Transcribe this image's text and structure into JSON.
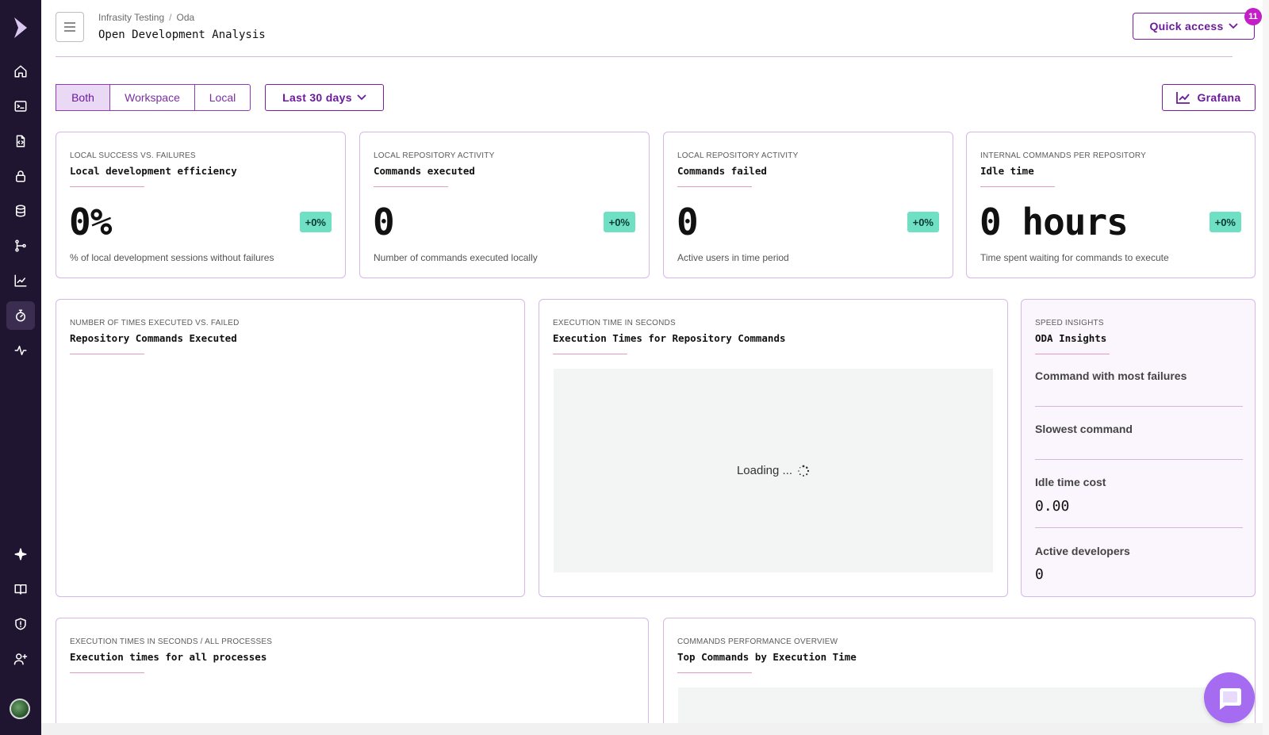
{
  "header": {
    "breadcrumb": [
      "Infrasity Testing",
      "Oda"
    ],
    "title": "Open Development Analysis",
    "quick_access_label": "Quick access",
    "quick_access_badge": "11"
  },
  "filters": {
    "scope_options": [
      "Both",
      "Workspace",
      "Local"
    ],
    "scope_selected": "Both",
    "date_range": "Last 30 days",
    "grafana_label": "Grafana"
  },
  "stats": [
    {
      "overline": "LOCAL SUCCESS VS. FAILURES",
      "title": "Local development efficiency",
      "value": "0%",
      "change": "+0%",
      "description": "% of local development sessions without failures"
    },
    {
      "overline": "LOCAL REPOSITORY ACTIVITY",
      "title": "Commands executed",
      "value": "0",
      "change": "+0%",
      "description": "Number of commands executed locally"
    },
    {
      "overline": "LOCAL REPOSITORY ACTIVITY",
      "title": "Commands failed",
      "value": "0",
      "change": "+0%",
      "description": "Active users in time period"
    },
    {
      "overline": "INTERNAL COMMANDS PER REPOSITORY",
      "title": "Idle time",
      "value": "0 hours",
      "change": "+0%",
      "description": "Time spent waiting for commands to execute"
    }
  ],
  "panels": {
    "repo_commands": {
      "overline": "NUMBER OF TIMES EXECUTED VS. FAILED",
      "title": "Repository Commands Executed"
    },
    "exec_times": {
      "overline": "EXECUTION TIME IN SECONDS",
      "title": "Execution Times for Repository Commands",
      "loading": "Loading ..."
    },
    "insights": {
      "overline": "SPEED INSIGHTS",
      "title": "ODA Insights",
      "items": [
        {
          "label": "Command with most failures",
          "value": ""
        },
        {
          "label": "Slowest command",
          "value": ""
        },
        {
          "label": "Idle time cost",
          "value": "0.00"
        },
        {
          "label": "Active developers",
          "value": "0"
        }
      ]
    },
    "all_processes": {
      "overline": "EXECUTION TIMES IN SECONDS / ALL PROCESSES",
      "title": "Execution times for all processes"
    },
    "top_commands": {
      "overline": "COMMANDS PERFORMANCE OVERVIEW",
      "title": "Top Commands by Execution Time"
    }
  },
  "sidebar": {
    "items": [
      "home-icon",
      "terminal-icon",
      "code-file-icon",
      "lock-icon",
      "database-icon",
      "branch-icon",
      "chart-icon",
      "stopwatch-icon",
      "activity-icon",
      "sparkle-icon",
      "book-icon",
      "shield-icon",
      "add-user-icon"
    ],
    "active": "stopwatch-icon"
  },
  "colors": {
    "sidebar_bg": "#1f1530",
    "accent": "#7a1fa2",
    "badge_green": "#6fe0c4",
    "notification": "#c21fc6",
    "chat": "#a56bf0"
  }
}
